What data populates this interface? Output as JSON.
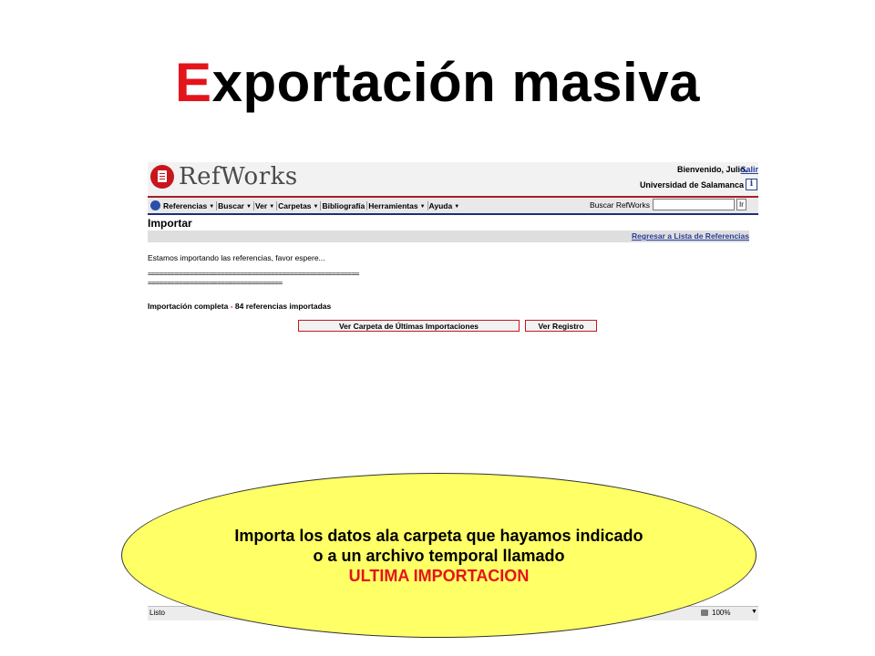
{
  "slide": {
    "title_first_letter": "E",
    "title_rest": "xportación masiva"
  },
  "app": {
    "logo_text": "RefWorks",
    "welcome": "Bienvenido, Julio.",
    "logout": "Salir",
    "institution": "Universidad de Salamanca",
    "info": "i"
  },
  "menu": [
    {
      "label": "Referencias"
    },
    {
      "label": "Buscar"
    },
    {
      "label": "Ver"
    },
    {
      "label": "Carpetas"
    },
    {
      "label": "Bibliografía"
    },
    {
      "label": "Herramientas"
    },
    {
      "label": "Ayuda"
    }
  ],
  "search": {
    "label": "Buscar RefWorks",
    "value": "",
    "button": "Ir"
  },
  "page": {
    "heading": "Importar",
    "back_link": "Regresar a Lista de Referencias",
    "message": "Estamos importando las referencias, favor espere...",
    "separator1": "=======================================================",
    "separator2": "===================================",
    "complete_label": "Importación completa",
    "complete_dash": " - ",
    "complete_count": "84 referencias importadas",
    "btn_folder": "Ver Carpeta de Últimas Importaciones",
    "btn_log": "Ver Registro"
  },
  "statusbar": {
    "text": "Listo",
    "zoom": "100%"
  },
  "callout": {
    "line1": "Importa los datos ala carpeta que hayamos indicado",
    "line2": "o a un archivo temporal llamado",
    "line3": "ULTIMA IMPORTACION"
  },
  "colors": {
    "title_accent": "#e4141b",
    "brand_red": "#c8161d",
    "link_blue": "#2a3f9b",
    "callout_fill": "#ffff66"
  }
}
